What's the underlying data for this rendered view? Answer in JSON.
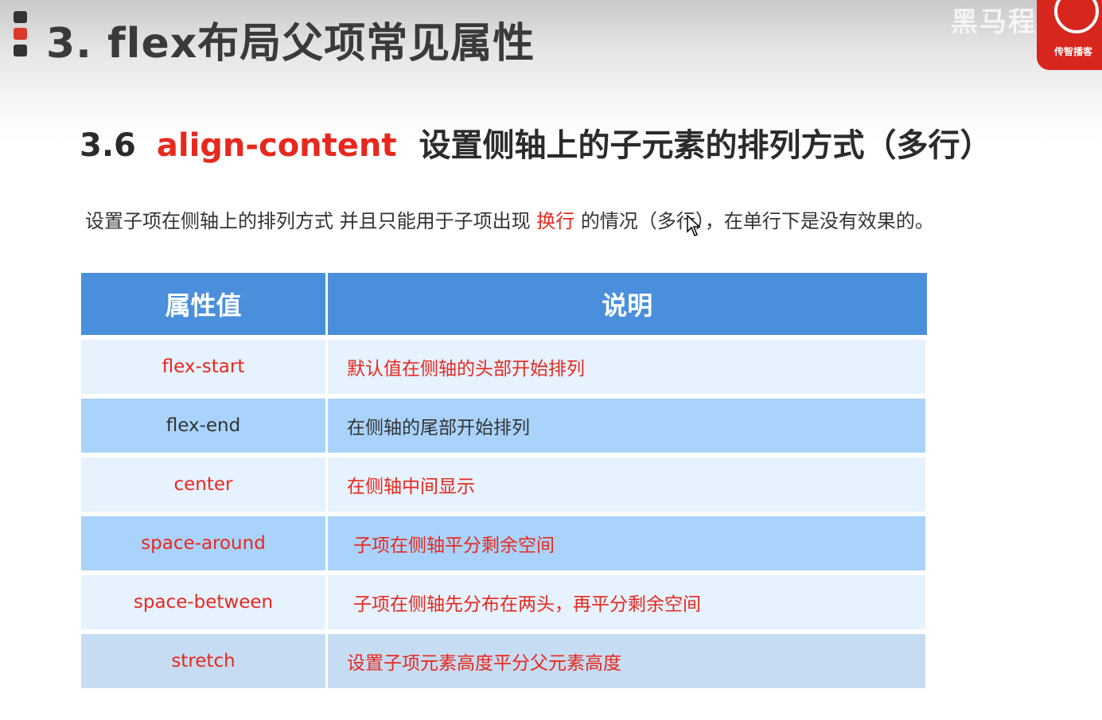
{
  "header": {
    "title": "3. flex布局父项常见属性",
    "logo_text": "黑马程序员",
    "badge_text": "传智播客"
  },
  "section": {
    "number": "3.6",
    "keyword": "align-content",
    "title": "设置侧轴上的子元素的排列方式（多行）"
  },
  "description": {
    "before": "设置子项在侧轴上的排列方式 并且只能用于子项出现 ",
    "highlight": "换行",
    "after": " 的情况（多行），在单行下是没有效果的。"
  },
  "table": {
    "headers": [
      "属性值",
      "说明"
    ],
    "rows": [
      {
        "value": "flex-start",
        "note": "默认值在侧轴的头部开始排列"
      },
      {
        "value": "flex-end",
        "note": "在侧轴的尾部开始排列"
      },
      {
        "value": "center",
        "note": "在侧轴中间显示"
      },
      {
        "value": "space-around",
        "note": "子项在侧轴平分剩余空间"
      },
      {
        "value": "space-between",
        "note": "子项在侧轴先分布在两头，再平分剩余空间"
      },
      {
        "value": "stretch",
        "note": "设置子项元素高度平分父元素高度"
      }
    ]
  },
  "colors": {
    "accent_red": "#e8281e",
    "header_blue": "#4a8fdc",
    "row_light": "#e6f2fe",
    "row_dark": "#a9d3fb"
  }
}
